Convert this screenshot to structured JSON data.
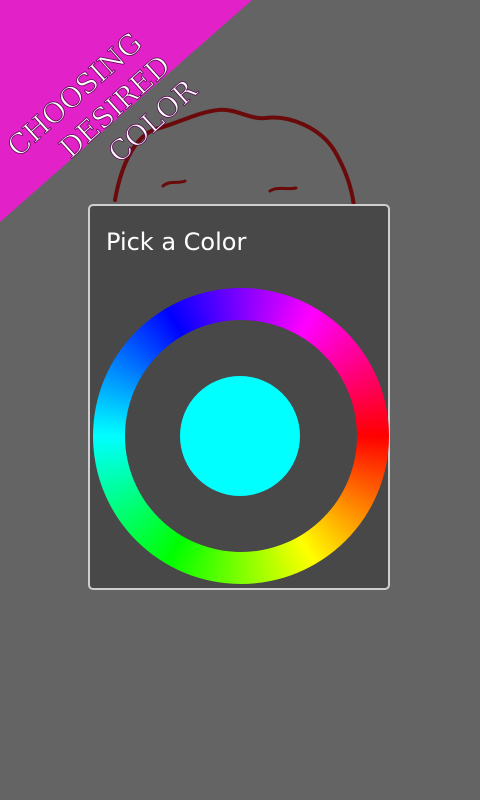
{
  "banner": {
    "lines": [
      "CHOOSING",
      "DESIRED",
      "COLOR"
    ],
    "color": "#e321c9",
    "text_color": "#ffffff"
  },
  "background": {
    "color": "#646464",
    "sketch_color": "#6b0a0a"
  },
  "dialog": {
    "title": "Pick a Color",
    "selected_color": "#00ffff"
  }
}
